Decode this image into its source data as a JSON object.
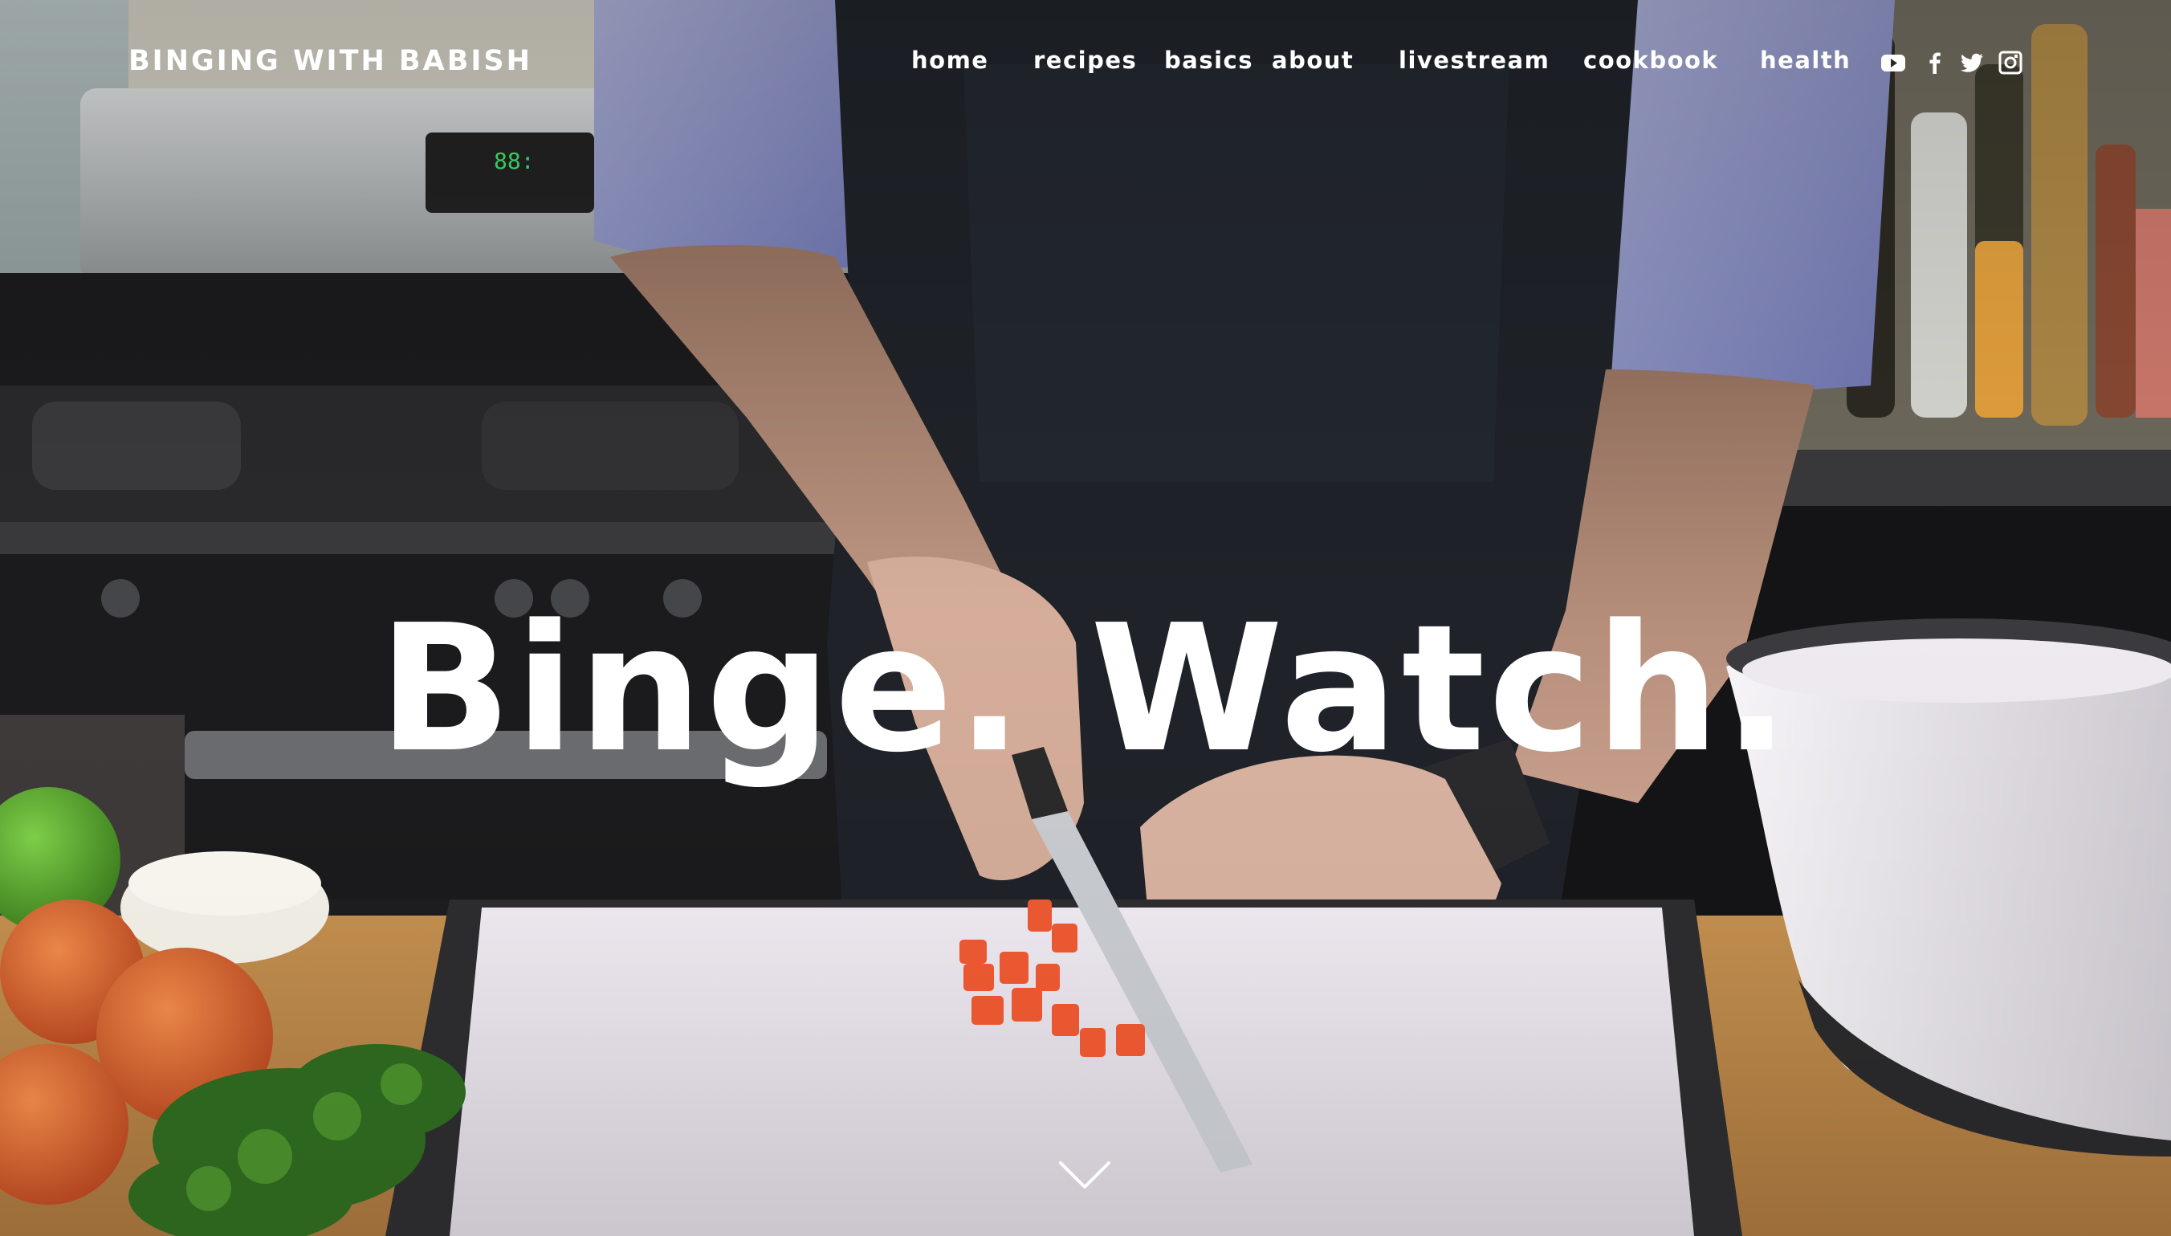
{
  "site": {
    "logo": "BINGING WITH BABISH"
  },
  "nav": {
    "items": [
      {
        "label": "home"
      },
      {
        "label": "recipes"
      },
      {
        "label": "basics"
      },
      {
        "label": "about"
      },
      {
        "label": "livestream"
      },
      {
        "label": "cookbook"
      },
      {
        "label": "health"
      }
    ]
  },
  "social": {
    "icons": [
      "youtube-icon",
      "facebook-icon",
      "twitter-icon",
      "instagram-icon"
    ]
  },
  "hero": {
    "headline": "Binge. Watch.",
    "scroll_icon": "chevron-down-icon"
  },
  "colors": {
    "text": "#ffffff",
    "apron": "#1f2329",
    "shirt": "#8d93c4",
    "counter": "#c8924e",
    "board": "#e9e4ee"
  }
}
